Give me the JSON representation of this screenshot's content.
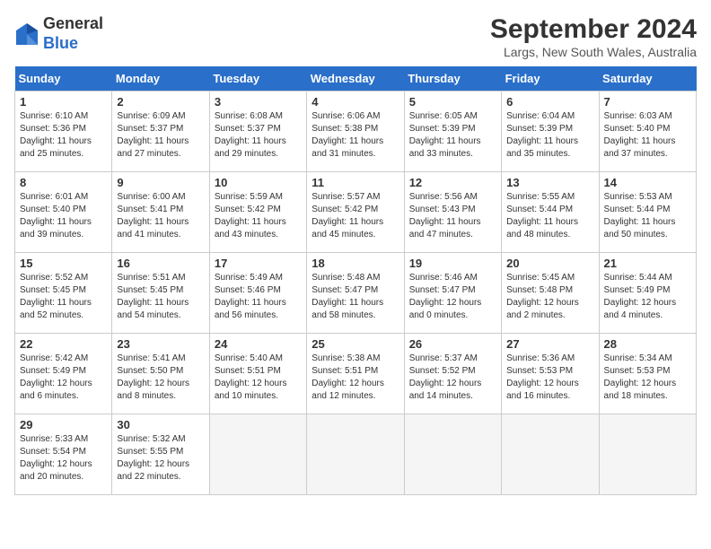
{
  "logo": {
    "general": "General",
    "blue": "Blue"
  },
  "title": "September 2024",
  "subtitle": "Largs, New South Wales, Australia",
  "days_header": [
    "Sunday",
    "Monday",
    "Tuesday",
    "Wednesday",
    "Thursday",
    "Friday",
    "Saturday"
  ],
  "weeks": [
    [
      {
        "num": "1",
        "info": "Sunrise: 6:10 AM\nSunset: 5:36 PM\nDaylight: 11 hours\nand 25 minutes."
      },
      {
        "num": "2",
        "info": "Sunrise: 6:09 AM\nSunset: 5:37 PM\nDaylight: 11 hours\nand 27 minutes."
      },
      {
        "num": "3",
        "info": "Sunrise: 6:08 AM\nSunset: 5:37 PM\nDaylight: 11 hours\nand 29 minutes."
      },
      {
        "num": "4",
        "info": "Sunrise: 6:06 AM\nSunset: 5:38 PM\nDaylight: 11 hours\nand 31 minutes."
      },
      {
        "num": "5",
        "info": "Sunrise: 6:05 AM\nSunset: 5:39 PM\nDaylight: 11 hours\nand 33 minutes."
      },
      {
        "num": "6",
        "info": "Sunrise: 6:04 AM\nSunset: 5:39 PM\nDaylight: 11 hours\nand 35 minutes."
      },
      {
        "num": "7",
        "info": "Sunrise: 6:03 AM\nSunset: 5:40 PM\nDaylight: 11 hours\nand 37 minutes."
      }
    ],
    [
      {
        "num": "8",
        "info": "Sunrise: 6:01 AM\nSunset: 5:40 PM\nDaylight: 11 hours\nand 39 minutes."
      },
      {
        "num": "9",
        "info": "Sunrise: 6:00 AM\nSunset: 5:41 PM\nDaylight: 11 hours\nand 41 minutes."
      },
      {
        "num": "10",
        "info": "Sunrise: 5:59 AM\nSunset: 5:42 PM\nDaylight: 11 hours\nand 43 minutes."
      },
      {
        "num": "11",
        "info": "Sunrise: 5:57 AM\nSunset: 5:42 PM\nDaylight: 11 hours\nand 45 minutes."
      },
      {
        "num": "12",
        "info": "Sunrise: 5:56 AM\nSunset: 5:43 PM\nDaylight: 11 hours\nand 47 minutes."
      },
      {
        "num": "13",
        "info": "Sunrise: 5:55 AM\nSunset: 5:44 PM\nDaylight: 11 hours\nand 48 minutes."
      },
      {
        "num": "14",
        "info": "Sunrise: 5:53 AM\nSunset: 5:44 PM\nDaylight: 11 hours\nand 50 minutes."
      }
    ],
    [
      {
        "num": "15",
        "info": "Sunrise: 5:52 AM\nSunset: 5:45 PM\nDaylight: 11 hours\nand 52 minutes."
      },
      {
        "num": "16",
        "info": "Sunrise: 5:51 AM\nSunset: 5:45 PM\nDaylight: 11 hours\nand 54 minutes."
      },
      {
        "num": "17",
        "info": "Sunrise: 5:49 AM\nSunset: 5:46 PM\nDaylight: 11 hours\nand 56 minutes."
      },
      {
        "num": "18",
        "info": "Sunrise: 5:48 AM\nSunset: 5:47 PM\nDaylight: 11 hours\nand 58 minutes."
      },
      {
        "num": "19",
        "info": "Sunrise: 5:46 AM\nSunset: 5:47 PM\nDaylight: 12 hours\nand 0 minutes."
      },
      {
        "num": "20",
        "info": "Sunrise: 5:45 AM\nSunset: 5:48 PM\nDaylight: 12 hours\nand 2 minutes."
      },
      {
        "num": "21",
        "info": "Sunrise: 5:44 AM\nSunset: 5:49 PM\nDaylight: 12 hours\nand 4 minutes."
      }
    ],
    [
      {
        "num": "22",
        "info": "Sunrise: 5:42 AM\nSunset: 5:49 PM\nDaylight: 12 hours\nand 6 minutes."
      },
      {
        "num": "23",
        "info": "Sunrise: 5:41 AM\nSunset: 5:50 PM\nDaylight: 12 hours\nand 8 minutes."
      },
      {
        "num": "24",
        "info": "Sunrise: 5:40 AM\nSunset: 5:51 PM\nDaylight: 12 hours\nand 10 minutes."
      },
      {
        "num": "25",
        "info": "Sunrise: 5:38 AM\nSunset: 5:51 PM\nDaylight: 12 hours\nand 12 minutes."
      },
      {
        "num": "26",
        "info": "Sunrise: 5:37 AM\nSunset: 5:52 PM\nDaylight: 12 hours\nand 14 minutes."
      },
      {
        "num": "27",
        "info": "Sunrise: 5:36 AM\nSunset: 5:53 PM\nDaylight: 12 hours\nand 16 minutes."
      },
      {
        "num": "28",
        "info": "Sunrise: 5:34 AM\nSunset: 5:53 PM\nDaylight: 12 hours\nand 18 minutes."
      }
    ],
    [
      {
        "num": "29",
        "info": "Sunrise: 5:33 AM\nSunset: 5:54 PM\nDaylight: 12 hours\nand 20 minutes."
      },
      {
        "num": "30",
        "info": "Sunrise: 5:32 AM\nSunset: 5:55 PM\nDaylight: 12 hours\nand 22 minutes."
      },
      {
        "num": "",
        "info": ""
      },
      {
        "num": "",
        "info": ""
      },
      {
        "num": "",
        "info": ""
      },
      {
        "num": "",
        "info": ""
      },
      {
        "num": "",
        "info": ""
      }
    ]
  ]
}
